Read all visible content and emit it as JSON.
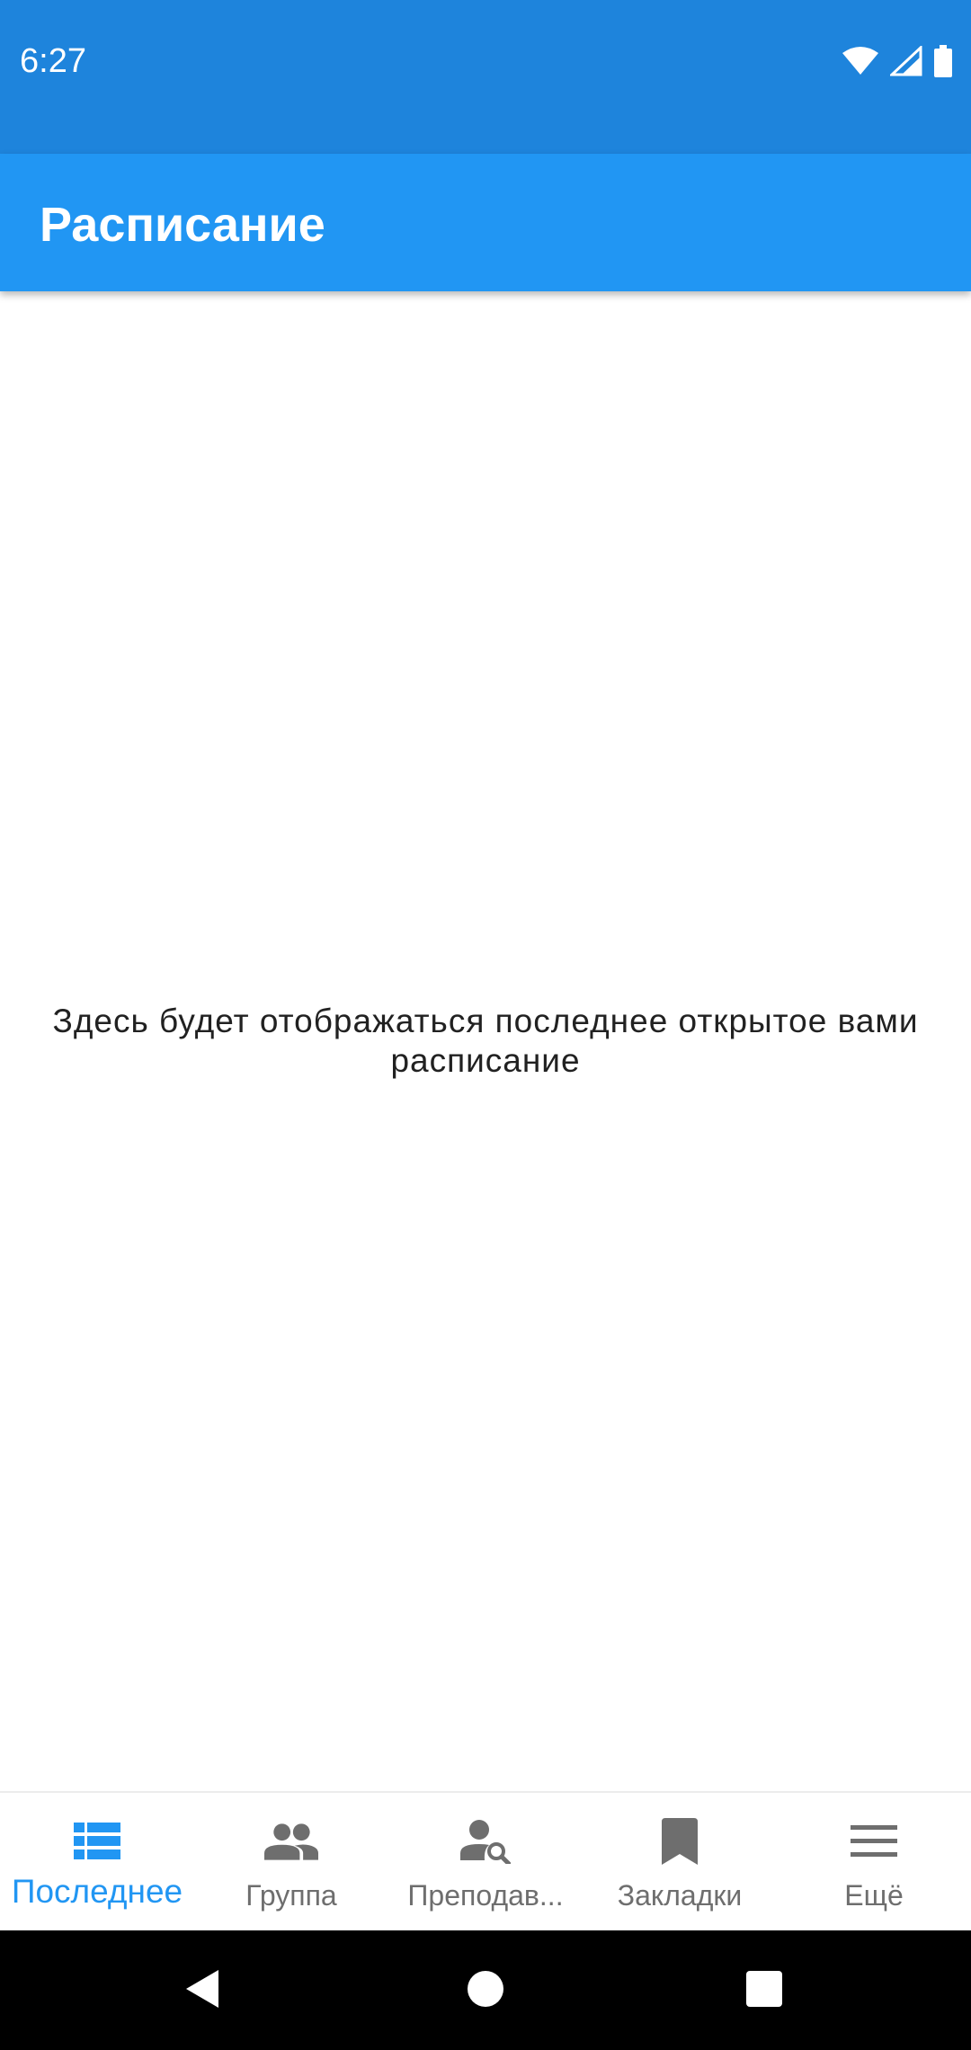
{
  "status_bar": {
    "time": "6:27",
    "icons": [
      "wifi-icon",
      "cellular-signal-icon",
      "battery-icon"
    ]
  },
  "app_bar": {
    "title": "Расписание"
  },
  "content": {
    "empty_message": "Здесь будет отображаться последнее открытое вами расписание"
  },
  "bottom_nav": {
    "items": [
      {
        "label": "Последнее",
        "icon": "list-icon",
        "active": true
      },
      {
        "label": "Группа",
        "icon": "group-icon",
        "active": false
      },
      {
        "label": "Преподав...",
        "icon": "person-search-icon",
        "active": false
      },
      {
        "label": "Закладки",
        "icon": "bookmark-icon",
        "active": false
      },
      {
        "label": "Ещё",
        "icon": "menu-icon",
        "active": false
      }
    ]
  },
  "system_nav": {
    "buttons": [
      "back-icon",
      "home-icon",
      "recents-icon"
    ]
  },
  "colors": {
    "status_bar": "#1e84dc",
    "app_bar": "#2196f3",
    "accent": "#2196f3",
    "inactive": "#6e6e6e"
  }
}
